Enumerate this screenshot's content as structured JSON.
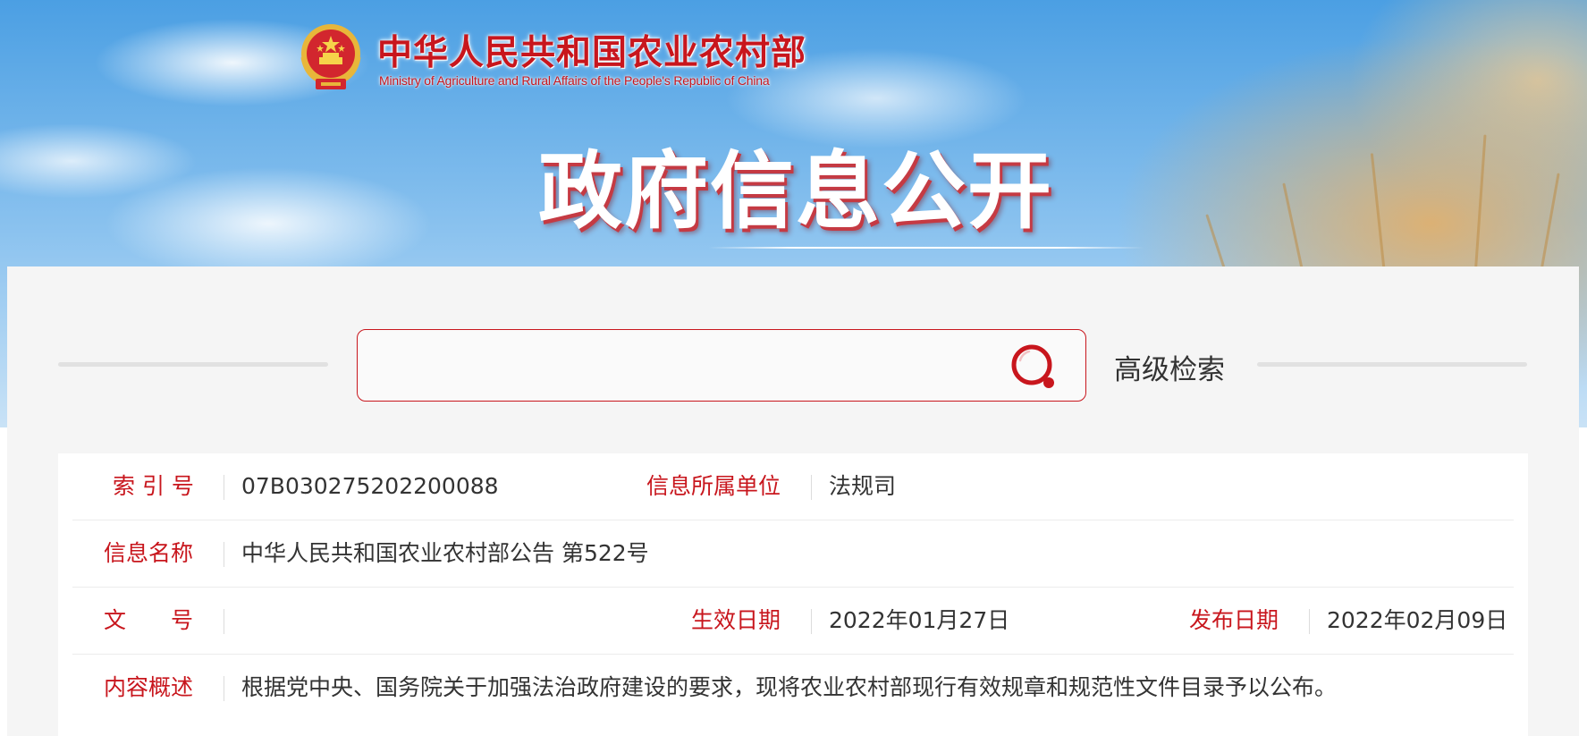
{
  "header": {
    "org_name_cn": "中华人民共和国农业农村部",
    "org_name_en": "Ministry of Agriculture and Rural Affairs of the People's Republic of China",
    "emblem_icon": "national-emblem-icon",
    "page_heading": "政府信息公开"
  },
  "search": {
    "placeholder": "",
    "value": "",
    "icon": "search-icon",
    "advanced_label": "高级检索"
  },
  "info": {
    "index_label": "索 引 号",
    "index_value": "07B030275202200088",
    "unit_label": "信息所属单位",
    "unit_value": "法规司",
    "name_label": "信息名称",
    "name_value": "中华人民共和国农业农村部公告 第522号",
    "docno_label": "文　　号",
    "docno_value": "",
    "effective_label": "生效日期",
    "effective_value": "2022年01月27日",
    "publish_label": "发布日期",
    "publish_value": "2022年02月09日",
    "summary_label": "内容概述",
    "summary_value": "根据党中央、国务院关于加强法治政府建设的要求，现将农业农村部现行有效规章和规范性文件目录予以公布。"
  },
  "colors": {
    "accent": "#c8161d",
    "panel_bg": "#f5f5f5",
    "text": "#333333"
  }
}
